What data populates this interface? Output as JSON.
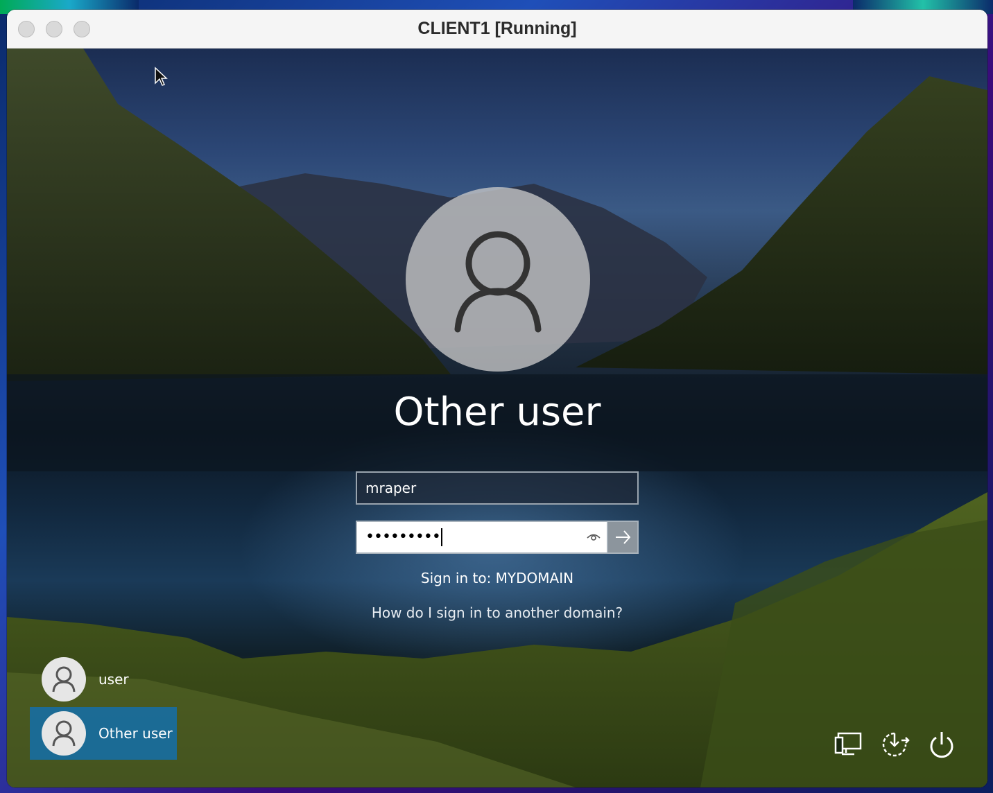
{
  "window": {
    "title": "CLIENT1 [Running]"
  },
  "login": {
    "display_name": "Other user",
    "username_value": "mraper",
    "password_mask": "•••••••••",
    "sign_in_to": "Sign in to: MYDOMAIN",
    "other_domain_link": "How do I sign in to another domain?"
  },
  "accounts": [
    {
      "label": "user",
      "selected": false
    },
    {
      "label": "Other user",
      "selected": true
    }
  ],
  "system_icons": [
    "network-icon",
    "accessibility-icon",
    "power-icon"
  ],
  "colors": {
    "selected_tile": "#146eaa",
    "text": "#ffffff"
  }
}
